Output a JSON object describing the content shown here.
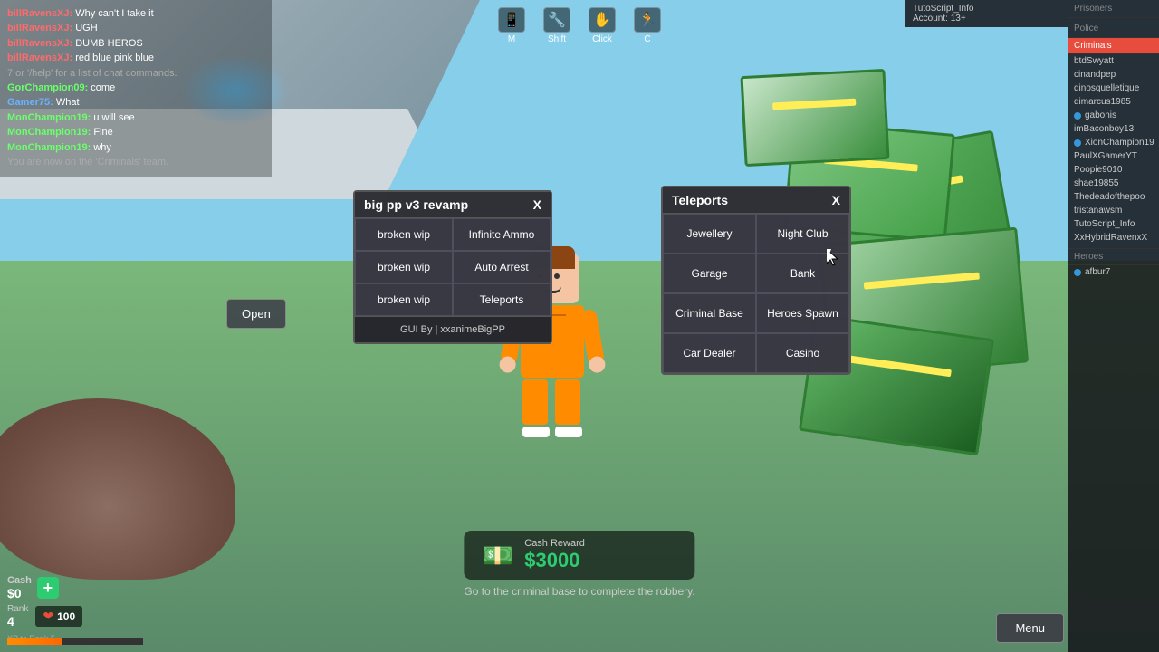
{
  "game": {
    "background_color": "#5a8a6a"
  },
  "account": {
    "username": "TutoScript_Info",
    "account_age": "Account: 13+"
  },
  "top_icons": [
    {
      "label": "M",
      "icon": "📱"
    },
    {
      "label": "Shift",
      "icon": "🔧"
    },
    {
      "label": "Click",
      "icon": "✋"
    },
    {
      "label": "C",
      "icon": "🏃"
    }
  ],
  "chat": {
    "messages": [
      {
        "name": "billRavensXJ:",
        "name_color": "red",
        "text": " Why can't I take it"
      },
      {
        "name": "billRavensXJ:",
        "name_color": "red",
        "text": " UGH"
      },
      {
        "name": "billRavensXJ:",
        "name_color": "red",
        "text": " DUMB HEROS"
      },
      {
        "name": "billRavensXJ:",
        "name_color": "red",
        "text": " red blue pink blue"
      },
      {
        "name": "",
        "name_color": "",
        "text": "7 or '/help' for a list of chat commands."
      },
      {
        "name": "GorChampion09:",
        "name_color": "green",
        "text": " come"
      },
      {
        "name": "Gamer75:",
        "name_color": "blue",
        "text": " What"
      },
      {
        "name": "MonChampion19:",
        "name_color": "green",
        "text": " u will see"
      },
      {
        "name": "MonChampion19:",
        "name_color": "green",
        "text": " Fine"
      },
      {
        "name": "MonChampion19:",
        "name_color": "green",
        "text": " why"
      },
      {
        "name": "",
        "name_color": "",
        "text": "You are now on the 'Criminals' team."
      }
    ]
  },
  "gui_panel": {
    "title": "big pp v3 revamp",
    "close_btn": "X",
    "buttons": [
      {
        "left": "broken wip",
        "right": "Infinite Ammo"
      },
      {
        "left": "broken wip",
        "right": "Auto Arrest"
      },
      {
        "left": "broken wip",
        "right": "Teleports"
      }
    ],
    "footer": "GUI By | xxanimeBigPP"
  },
  "teleports_panel": {
    "title": "Teleports",
    "close_btn": "X",
    "buttons": [
      "Jewellery",
      "Night Club",
      "Garage",
      "Bank",
      "Criminal Base",
      "Heroes Spawn",
      "Car Dealer",
      "Casino"
    ]
  },
  "sidebar": {
    "sections": [
      {
        "label": "Prisoners",
        "items": []
      },
      {
        "label": "Police",
        "items": []
      },
      {
        "label": "Criminals",
        "is_active": true,
        "items": [
          {
            "name": "btdSwyatt",
            "has_dot": false
          },
          {
            "name": "cinandpep",
            "has_dot": false
          },
          {
            "name": "dinosquelletique",
            "has_dot": false
          },
          {
            "name": "dimarcus1985",
            "has_dot": false
          },
          {
            "name": "gabonis",
            "has_dot": true,
            "dot_color": "blue"
          },
          {
            "name": "imBaconboy13",
            "has_dot": false
          },
          {
            "name": "XionChampion19",
            "has_dot": true,
            "dot_color": "blue"
          },
          {
            "name": "PaulXGamerYT",
            "has_dot": false
          },
          {
            "name": "Poopie9010",
            "has_dot": false
          },
          {
            "name": "shae19855",
            "has_dot": false
          },
          {
            "name": "Thedeadofthepoo",
            "has_dot": false
          },
          {
            "name": "tristanawsm",
            "has_dot": false
          },
          {
            "name": "TutoScript_Info",
            "has_dot": false
          },
          {
            "name": "XxHybridRavenxX",
            "has_dot": false
          }
        ]
      },
      {
        "label": "Heroes",
        "items": [
          {
            "name": "afbur7",
            "has_dot": true,
            "dot_color": "blue"
          }
        ]
      }
    ]
  },
  "bottom_hud": {
    "cash_label": "Cash",
    "cash_amount": "$0",
    "add_btn": "+",
    "rank_label": "Rank",
    "rank_value": "4",
    "hp_label": "HP",
    "hp_value": "100",
    "xp_label": "XP to Rank 5"
  },
  "reward": {
    "label": "Cash Reward",
    "amount": "$3000",
    "mission": "Go to the criminal base to complete the robbery."
  },
  "open_btn": "Open",
  "menu_btn": "Menu"
}
